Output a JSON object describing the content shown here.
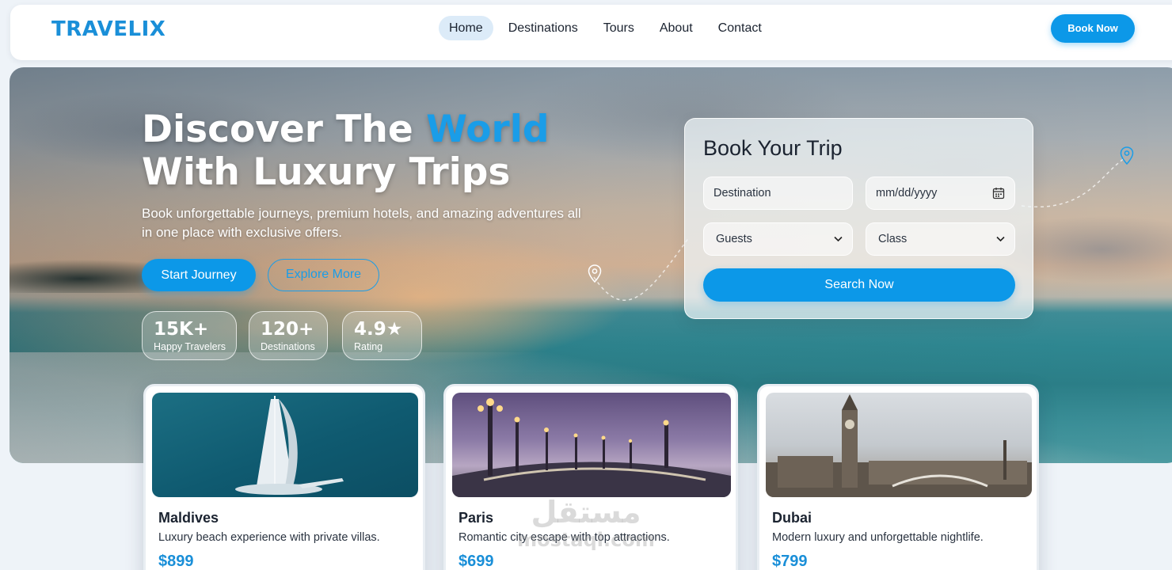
{
  "nav": {
    "logo": "TRAVELIX",
    "links": [
      "Home",
      "Destinations",
      "Tours",
      "About",
      "Contact"
    ],
    "active": "Home",
    "cta": "Book Now"
  },
  "hero": {
    "title_part1": "Discover The ",
    "title_accent": "World",
    "title_line2": "With Luxury Trips",
    "subtitle": "Book unforgettable journeys, premium hotels, and amazing adventures all in one place with exclusive offers.",
    "primary_cta": "Start Journey",
    "secondary_cta": "Explore More",
    "stats": [
      {
        "value": "15K+",
        "label": "Happy Travelers"
      },
      {
        "value": "120+",
        "label": "Destinations"
      },
      {
        "value": "4.9★",
        "label": "Rating"
      }
    ]
  },
  "booking": {
    "title": "Book Your Trip",
    "destination_placeholder": "Destination",
    "date_placeholder": "mm/dd/yyyy",
    "guests_label": "Guests",
    "class_label": "Class",
    "search_label": "Search Now"
  },
  "destinations": [
    {
      "name": "Maldives",
      "description": "Luxury beach experience with private villas.",
      "price": "$899"
    },
    {
      "name": "Paris",
      "description": "Romantic city escape with top attractions.",
      "price": "$699"
    },
    {
      "name": "Dubai",
      "description": "Modern luxury and unforgettable nightlife.",
      "price": "$799"
    }
  ],
  "watermark": {
    "arabic": "مستقل",
    "latin": "mostaql.com"
  },
  "colors": {
    "accent": "#0c98e8",
    "brand": "#1a8fd8",
    "text": "#1b2330"
  }
}
